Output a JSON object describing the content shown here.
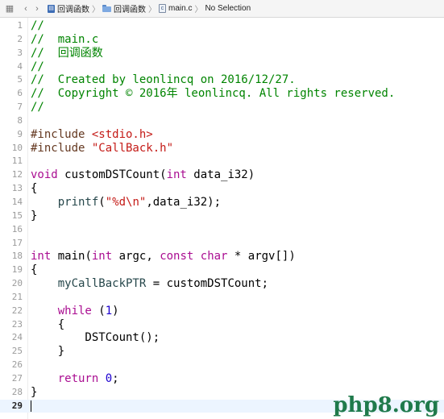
{
  "jumpbar": {
    "crumbs": [
      "回调函数",
      "回调函数",
      "main.c",
      "No Selection"
    ]
  },
  "editor": {
    "current_line": 29,
    "lines": [
      {
        "n": "1",
        "t": [
          {
            "c": "comment",
            "s": "//"
          }
        ]
      },
      {
        "n": "2",
        "t": [
          {
            "c": "comment",
            "s": "//  main.c"
          }
        ]
      },
      {
        "n": "3",
        "t": [
          {
            "c": "comment",
            "s": "//  回调函数"
          }
        ]
      },
      {
        "n": "4",
        "t": [
          {
            "c": "comment",
            "s": "//"
          }
        ]
      },
      {
        "n": "5",
        "t": [
          {
            "c": "comment",
            "s": "//  Created by leonlincq on 2016/12/27."
          }
        ]
      },
      {
        "n": "6",
        "t": [
          {
            "c": "comment",
            "s": "//  Copyright © 2016年 leonlincq. All rights reserved."
          }
        ]
      },
      {
        "n": "7",
        "t": [
          {
            "c": "comment",
            "s": "//"
          }
        ]
      },
      {
        "n": "8",
        "t": []
      },
      {
        "n": "9",
        "t": [
          {
            "c": "pp",
            "s": "#include "
          },
          {
            "c": "str",
            "s": "<stdio.h>"
          }
        ]
      },
      {
        "n": "10",
        "t": [
          {
            "c": "pp",
            "s": "#include "
          },
          {
            "c": "str",
            "s": "\"CallBack.h\""
          }
        ]
      },
      {
        "n": "11",
        "t": []
      },
      {
        "n": "12",
        "t": [
          {
            "c": "kw",
            "s": "void"
          },
          {
            "c": "plain",
            "s": " customDSTCount("
          },
          {
            "c": "kw",
            "s": "int"
          },
          {
            "c": "plain",
            "s": " data_i32)"
          }
        ]
      },
      {
        "n": "13",
        "t": [
          {
            "c": "plain",
            "s": "{"
          }
        ]
      },
      {
        "n": "14",
        "t": [
          {
            "c": "plain",
            "s": "    "
          },
          {
            "c": "fn",
            "s": "printf"
          },
          {
            "c": "plain",
            "s": "("
          },
          {
            "c": "str",
            "s": "\"%d\\n\""
          },
          {
            "c": "plain",
            "s": ",data_i32);"
          }
        ]
      },
      {
        "n": "15",
        "t": [
          {
            "c": "plain",
            "s": "}"
          }
        ]
      },
      {
        "n": "16",
        "t": []
      },
      {
        "n": "17",
        "t": []
      },
      {
        "n": "18",
        "t": [
          {
            "c": "kw",
            "s": "int"
          },
          {
            "c": "plain",
            "s": " main("
          },
          {
            "c": "kw",
            "s": "int"
          },
          {
            "c": "plain",
            "s": " argc, "
          },
          {
            "c": "kw",
            "s": "const char"
          },
          {
            "c": "plain",
            "s": " * argv[])"
          }
        ]
      },
      {
        "n": "19",
        "t": [
          {
            "c": "plain",
            "s": "{"
          }
        ]
      },
      {
        "n": "20",
        "t": [
          {
            "c": "plain",
            "s": "    "
          },
          {
            "c": "fn",
            "s": "myCallBackPTR"
          },
          {
            "c": "plain",
            "s": " = customDSTCount;"
          }
        ]
      },
      {
        "n": "21",
        "t": []
      },
      {
        "n": "22",
        "t": [
          {
            "c": "plain",
            "s": "    "
          },
          {
            "c": "kw",
            "s": "while"
          },
          {
            "c": "plain",
            "s": " ("
          },
          {
            "c": "num",
            "s": "1"
          },
          {
            "c": "plain",
            "s": ")"
          }
        ]
      },
      {
        "n": "23",
        "t": [
          {
            "c": "plain",
            "s": "    {"
          }
        ]
      },
      {
        "n": "24",
        "t": [
          {
            "c": "plain",
            "s": "        DSTCount();"
          }
        ]
      },
      {
        "n": "25",
        "t": [
          {
            "c": "plain",
            "s": "    }"
          }
        ]
      },
      {
        "n": "26",
        "t": []
      },
      {
        "n": "27",
        "t": [
          {
            "c": "plain",
            "s": "    "
          },
          {
            "c": "kw",
            "s": "return"
          },
          {
            "c": "plain",
            "s": " "
          },
          {
            "c": "num",
            "s": "0"
          },
          {
            "c": "plain",
            "s": ";"
          }
        ]
      },
      {
        "n": "28",
        "t": [
          {
            "c": "plain",
            "s": "}"
          }
        ]
      },
      {
        "n": "29",
        "t": []
      }
    ]
  },
  "watermark": {
    "text": "php8.org",
    "color": "#1f7a4b"
  }
}
